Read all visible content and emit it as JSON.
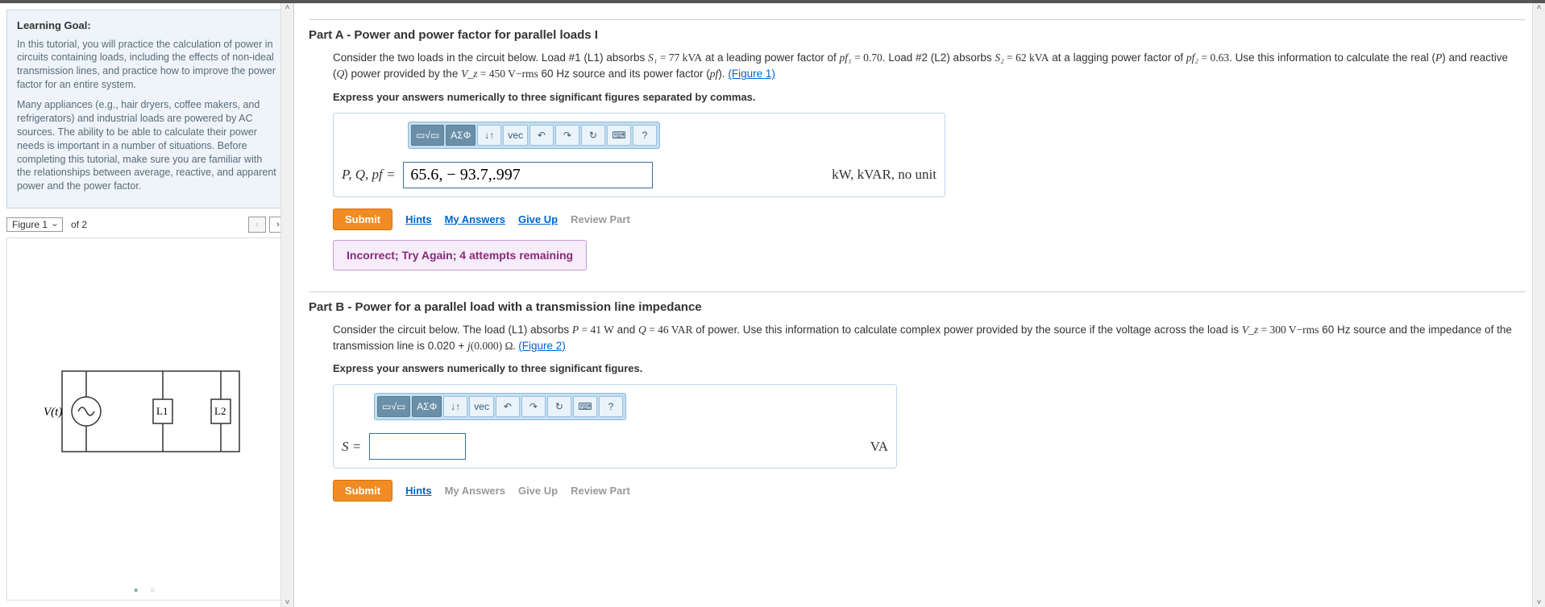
{
  "learning_goal": {
    "heading": "Learning Goal:",
    "para1": "In this tutorial, you will practice the calculation of power in circuits containing loads, including the effects of non-ideal transmission lines, and practice how to improve the power factor for an entire system.",
    "para2": "Many appliances (e.g., hair dryers, coffee makers, and refrigerators) and industrial loads are powered by AC sources. The ability to be able to calculate their power needs is important in a number of situations. Before completing this tutorial, make sure you are familiar with the relationships between average, reactive, and apparent power and the power factor."
  },
  "figure_pager": {
    "selected": "Figure 1",
    "of_text": "of 2"
  },
  "circuit": {
    "source_label": "V(t)",
    "load1": "L1",
    "load2": "L2"
  },
  "partA": {
    "title_prefix": "Part A",
    "title_rest": " - Power and power factor for parallel loads I",
    "body_pre": "Consider the two loads in the circuit below. Load #1 (L1) absorbs ",
    "s1_sym": "S₁",
    "s1_val": " = 77 kVA",
    "body_pf1a": " at a leading power factor of ",
    "pf1_sym": "pf₁",
    "pf1_val": " = 0.70",
    "body_mid": ". Load #2 (L2) absorbs ",
    "s2_sym": "S₂",
    "s2_val": " = 62 kVA",
    "body_pf2a": " at a lagging power factor of ",
    "pf2_sym": "pf₂",
    "pf2_val": " = 0.63",
    "body_tail1": ". Use this information to calculate the real (",
    "p_sym": "P",
    "body_tail2": ") and reactive (",
    "q_sym": "Q",
    "body_tail3": ") power provided by the ",
    "vz_sym": "V_z",
    "vz_val": " = 450 V−rms",
    "body_tail4": " 60 Hz source and its power factor (",
    "pf_sym": "pf",
    "body_tail5": ").",
    "fig_link": "(Figure 1)",
    "instruction": "Express your answers numerically to three significant figures separated by commas.",
    "lhs": "P, Q, pf = ",
    "value": "65.6, − 93.7,.997",
    "units": "kW, kVAR, no unit",
    "feedback": "Incorrect; Try Again; 4 attempts remaining"
  },
  "partB": {
    "title_prefix": "Part B",
    "title_rest": " - Power for a parallel load with a transmission line impedance",
    "body1": "Consider the circuit below. The load (L1) absorbs ",
    "p_sym": "P",
    "p_val": " = 41 W",
    "body2": " and ",
    "q_sym": "Q",
    "q_val": " = 46 VAR",
    "body3": " of power. Use this information to calculate complex power provided by the source if the voltage across the load is ",
    "vz_sym": "V_z",
    "vz_val": " = 300 V−rms",
    "body4": " 60 Hz source and the impedance of the transmission line is 0.020 + ",
    "j_sym": "j",
    "imp_tail": "(0.000) Ω. ",
    "fig_link": "(Figure 2)",
    "instruction": "Express your answers numerically to three significant figures.",
    "lhs": "S = ",
    "value": "",
    "units": "VA"
  },
  "toolbar": {
    "templates": "▭√▭",
    "greek": "ΑΣΦ",
    "subsup": "↓↑",
    "vec": "vec",
    "undo": "↶",
    "redo": "↷",
    "reset": "↻",
    "keyboard": "⌨",
    "help": "?"
  },
  "actions": {
    "submit": "Submit",
    "hints": "Hints",
    "myanswers": "My Answers",
    "giveup": "Give Up",
    "review": "Review Part"
  }
}
